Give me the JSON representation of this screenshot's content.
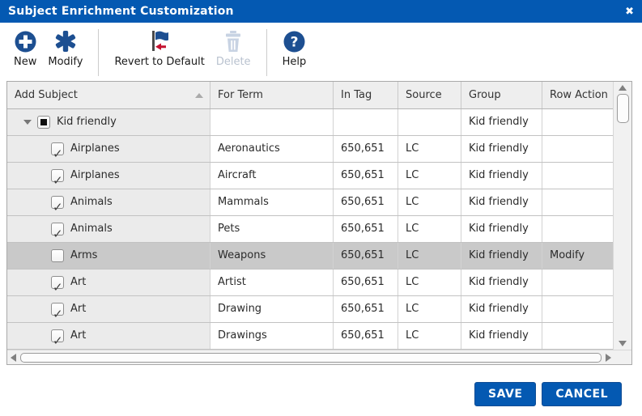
{
  "dialog": {
    "title": "Subject Enrichment Customization",
    "close_icon": "✖"
  },
  "toolbar": {
    "new_label": "New",
    "modify_label": "Modify",
    "revert_label": "Revert to Default",
    "delete_label": "Delete",
    "help_label": "Help",
    "delete_enabled": false
  },
  "table": {
    "columns": {
      "add_subject": "Add Subject",
      "for_term": "For Term",
      "in_tag": "In Tag",
      "source": "Source",
      "group": "Group",
      "row_action": "Row Action"
    },
    "sorted_column": "Add Subject",
    "sort_direction": "asc",
    "group_row": {
      "label": "Kid friendly",
      "for_term": "",
      "in_tag": "",
      "source": "",
      "group": "Kid friendly",
      "row_action": "",
      "checkbox_state": "indeterminate",
      "expanded": true
    },
    "rows": [
      {
        "subject": "Airplanes",
        "for_term": "Aeronautics",
        "in_tag": "650,651",
        "source": "LC",
        "group": "Kid friendly",
        "row_action": "",
        "checked": true,
        "highlighted": false
      },
      {
        "subject": "Airplanes",
        "for_term": "Aircraft",
        "in_tag": "650,651",
        "source": "LC",
        "group": "Kid friendly",
        "row_action": "",
        "checked": true,
        "highlighted": false
      },
      {
        "subject": "Animals",
        "for_term": "Mammals",
        "in_tag": "650,651",
        "source": "LC",
        "group": "Kid friendly",
        "row_action": "",
        "checked": true,
        "highlighted": false
      },
      {
        "subject": "Animals",
        "for_term": "Pets",
        "in_tag": "650,651",
        "source": "LC",
        "group": "Kid friendly",
        "row_action": "",
        "checked": true,
        "highlighted": false
      },
      {
        "subject": "Arms",
        "for_term": "Weapons",
        "in_tag": "650,651",
        "source": "LC",
        "group": "Kid friendly",
        "row_action": "Modify",
        "checked": false,
        "highlighted": true
      },
      {
        "subject": "Art",
        "for_term": "Artist",
        "in_tag": "650,651",
        "source": "LC",
        "group": "Kid friendly",
        "row_action": "",
        "checked": true,
        "highlighted": false
      },
      {
        "subject": "Art",
        "for_term": "Drawing",
        "in_tag": "650,651",
        "source": "LC",
        "group": "Kid friendly",
        "row_action": "",
        "checked": true,
        "highlighted": false
      },
      {
        "subject": "Art",
        "for_term": "Drawings",
        "in_tag": "650,651",
        "source": "LC",
        "group": "Kid friendly",
        "row_action": "",
        "checked": true,
        "highlighted": false
      }
    ]
  },
  "footer": {
    "save_label": "SAVE",
    "cancel_label": "CANCEL"
  },
  "colors": {
    "titlebar_blue": "#0459b2",
    "icon_navy": "#1d4f91",
    "revert_arrow_red": "#c41230",
    "disabled_icon": "#c8d3e3",
    "highlight_row": "#c9c9c9",
    "button_blue": "#0459b2"
  }
}
